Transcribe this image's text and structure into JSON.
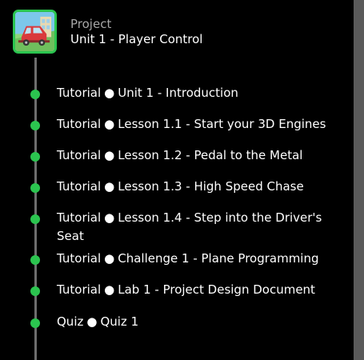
{
  "header": {
    "eyebrow": "Project",
    "title": "Unit 1 - Player Control"
  },
  "separator": "●",
  "items": [
    {
      "type": "Tutorial",
      "title": "Unit 1 - Introduction"
    },
    {
      "type": "Tutorial",
      "title": "Lesson 1.1 - Start your 3D Engines"
    },
    {
      "type": "Tutorial",
      "title": "Lesson 1.2 - Pedal to the Metal"
    },
    {
      "type": "Tutorial",
      "title": "Lesson 1.3 - High Speed Chase"
    },
    {
      "type": "Tutorial",
      "title": "Lesson 1.4 - Step into the Driver's Seat"
    },
    {
      "type": "Tutorial",
      "title": "Challenge 1 - Plane Programming"
    },
    {
      "type": "Tutorial",
      "title": "Lab 1 - Project Design Document"
    },
    {
      "type": "Quiz",
      "title": "Quiz 1"
    }
  ],
  "colors": {
    "accent": "#2bc44f",
    "track": "#6e6e6e",
    "muted_text": "#a7a7a7",
    "scrollbar": "#5a5a5a"
  }
}
